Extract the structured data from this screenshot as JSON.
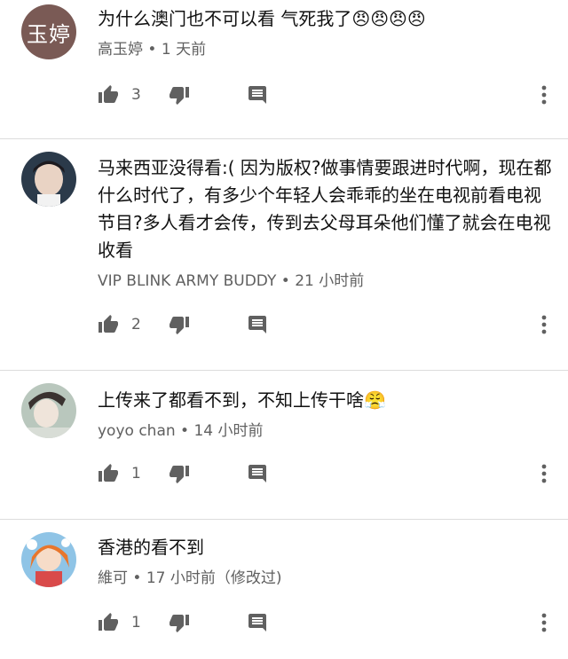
{
  "colors": {
    "text": "#111111",
    "meta": "#606060",
    "icon": "#606060",
    "divider": "#dcdcdc",
    "avatar_bg": "#7a5a55"
  },
  "comments": [
    {
      "avatar_text": "玉婷",
      "text": "为什么澳门也不可以看  气死我了😠😠😠😠",
      "author": "高玉婷",
      "time": "1 天前",
      "likes": "3"
    },
    {
      "avatar_text": "",
      "text": "马来西亚没得看:( 因为版权?做事情要跟进时代啊，现在都什么时代了，有多少个年轻人会乖乖的坐在电视前看电视节目?多人看才会传，传到去父母耳朵他们懂了就会在电视收看",
      "author": "VIP BLINK ARMY BUDDY",
      "time": "21 小时前",
      "likes": "2"
    },
    {
      "avatar_text": "",
      "text": "上传来了都看不到，不知上传干啥😤",
      "author": "yoyo chan",
      "time": "14 小时前",
      "likes": "1"
    },
    {
      "avatar_text": "",
      "text": "香港的看不到",
      "author": "維可",
      "time": "17 小时前（修改过)",
      "likes": "1"
    }
  ],
  "separator": "•",
  "icons": [
    "thumb-up-icon",
    "thumb-down-icon",
    "reply-icon",
    "more-vert-icon"
  ]
}
